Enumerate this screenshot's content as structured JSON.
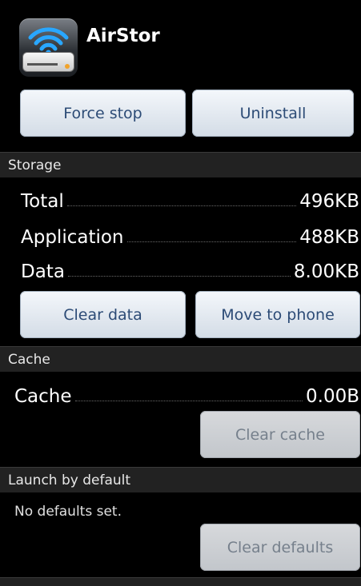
{
  "app": {
    "name": "AirStor",
    "icon": "airstor-wifi-drive-icon"
  },
  "header_buttons": {
    "force_stop": "Force stop",
    "uninstall": "Uninstall"
  },
  "storage": {
    "title": "Storage",
    "rows": [
      {
        "label": "Total",
        "value": "496KB"
      },
      {
        "label": "Application",
        "value": "488KB"
      },
      {
        "label": "Data",
        "value": "8.00KB"
      }
    ],
    "clear_data": "Clear data",
    "move_to_phone": "Move to phone"
  },
  "cache": {
    "title": "Cache",
    "label": "Cache",
    "value": "0.00B",
    "clear_cache": "Clear cache"
  },
  "launch": {
    "title": "Launch by default",
    "text": "No defaults set.",
    "clear_defaults": "Clear defaults"
  },
  "colors": {
    "background": "#000000",
    "section_bg": "#222222",
    "button_text": "#2c4b76",
    "disabled_text": "#76808c"
  }
}
